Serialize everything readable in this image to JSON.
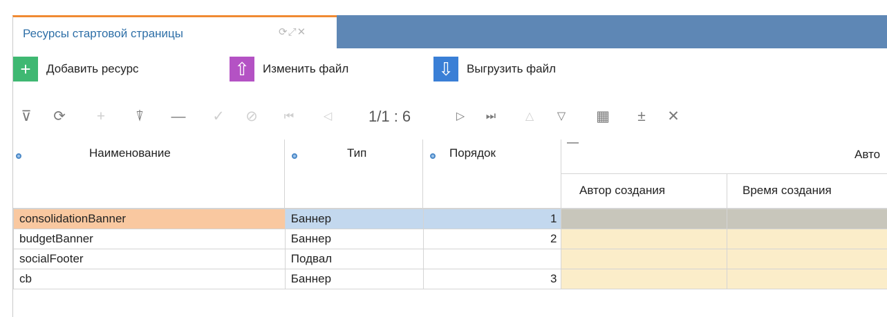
{
  "tab": {
    "title": "Ресурсы стартовой страницы",
    "icons": [
      "refresh-icon",
      "expand-icon",
      "close-icon"
    ],
    "icon_glyphs": "⟳⤢✕"
  },
  "actions": [
    {
      "label": "Добавить ресурс",
      "icon": "plus-icon",
      "glyph": "+",
      "color": "#3fb872"
    },
    {
      "label": "Изменить файл",
      "icon": "upload-arrow-icon",
      "glyph": "⇧",
      "color": "#b452c4"
    },
    {
      "label": "Выгрузить файл",
      "icon": "download-arrow-icon",
      "glyph": "⇩",
      "color": "#3a7fd6"
    }
  ],
  "toolbar": {
    "pager": "1/1 : 6",
    "tools": [
      {
        "name": "filter-icon",
        "glyph": "⊽"
      },
      {
        "name": "refresh-icon",
        "glyph": "⟳"
      },
      {
        "name": "add-row-icon",
        "glyph": "+"
      },
      {
        "name": "filter-clear-icon",
        "glyph": "⍒"
      },
      {
        "name": "delete-row-icon",
        "glyph": "—"
      },
      {
        "name": "confirm-icon",
        "glyph": "✓"
      },
      {
        "name": "cancel-icon",
        "glyph": "⊘"
      },
      {
        "name": "first-page-icon",
        "glyph": "⏮"
      },
      {
        "name": "prev-page-icon",
        "glyph": "◁"
      },
      {
        "name": "next-page-icon",
        "glyph": "▷"
      },
      {
        "name": "last-page-icon",
        "glyph": "⏭"
      },
      {
        "name": "sort-up-icon",
        "glyph": "△"
      },
      {
        "name": "sort-down-icon",
        "glyph": "▽"
      },
      {
        "name": "grid-icon",
        "glyph": "▦"
      },
      {
        "name": "expand-group-icon",
        "glyph": "±"
      },
      {
        "name": "close-panel-icon",
        "glyph": "✕"
      }
    ]
  },
  "grid": {
    "columns": {
      "name": "Наименование",
      "type": "Тип",
      "order": "Порядок",
      "group": "Авто",
      "author": "Автор создания",
      "created": "Время создания"
    },
    "group_collapse": "—",
    "rows": [
      {
        "name": "consolidationBanner",
        "type": "Баннер",
        "order": "1"
      },
      {
        "name": "budgetBanner",
        "type": "Баннер",
        "order": "2"
      },
      {
        "name": "socialFooter",
        "type": "Подвал",
        "order": ""
      },
      {
        "name": "cb",
        "type": "Баннер",
        "order": "3"
      }
    ]
  },
  "colors": {
    "tab_accent": "#f08a32",
    "tab_strip": "#5e87b5",
    "selected_name": "#f9c8a0",
    "selected_type": "#c3d8ee",
    "selected_audit": "#c8c6bb",
    "audit_cell": "#fbedc9"
  }
}
